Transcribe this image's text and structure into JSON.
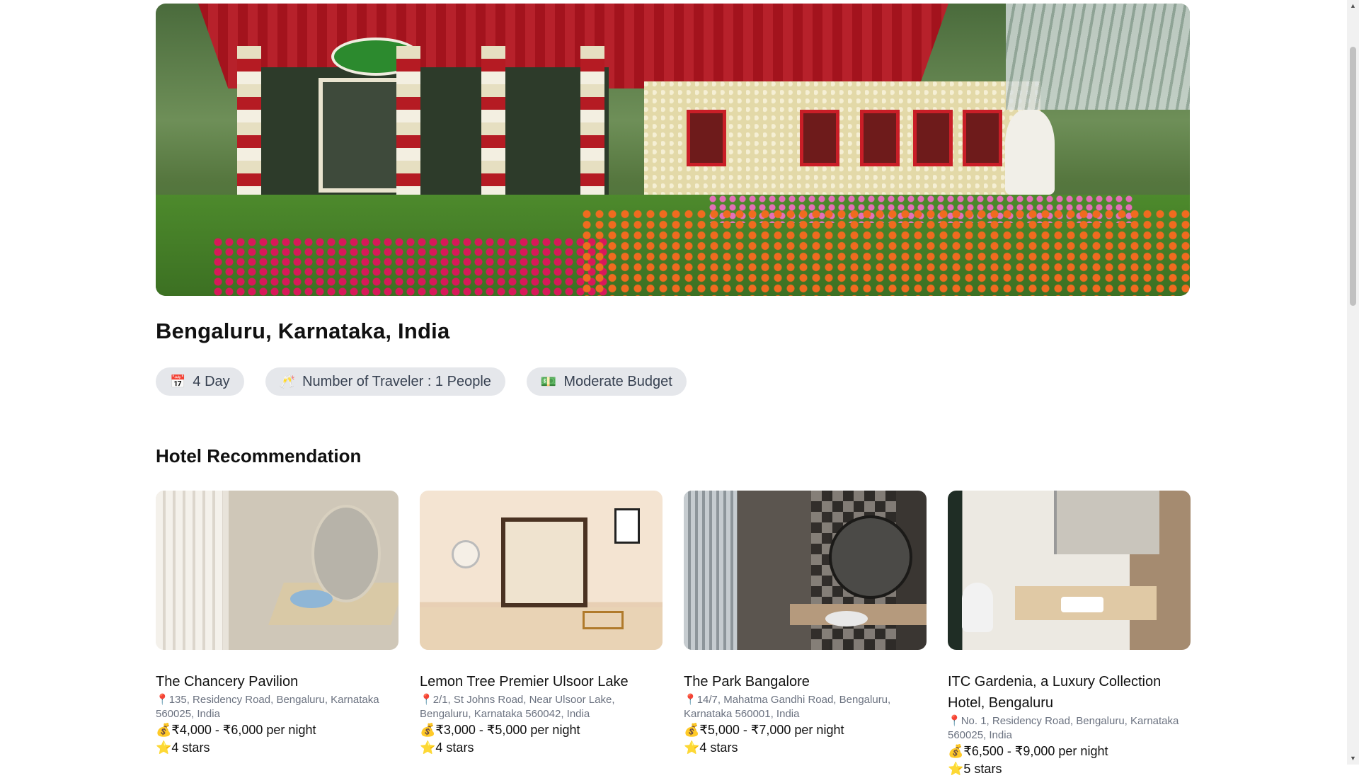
{
  "trip": {
    "location": "Bengaluru, Karnataka, India",
    "chips": [
      {
        "icon": "calendar-icon",
        "emoji": "📅",
        "label": "4 Day"
      },
      {
        "icon": "traveler-icon",
        "emoji": "🥂",
        "label": "Number of Traveler : 1 People"
      },
      {
        "icon": "money-icon",
        "emoji": "💵",
        "label": "Moderate Budget"
      }
    ]
  },
  "hotels_section": {
    "title": "Hotel Recommendation",
    "items": [
      {
        "name": "The Chancery Pavilion",
        "address": "135, Residency Road, Bengaluru, Karnataka 560025, India",
        "price": "₹4,000 - ₹6,000 per night",
        "rating": "4 stars"
      },
      {
        "name": "Lemon Tree Premier Ulsoor Lake",
        "address": "2/1, St Johns Road, Near Ulsoor Lake, Bengaluru, Karnataka 560042, India",
        "price": "₹3,000 - ₹5,000 per night",
        "rating": "4 stars"
      },
      {
        "name": "The Park Bangalore",
        "address": "14/7, Mahatma Gandhi Road, Bengaluru, Karnataka 560001, India",
        "price": "₹5,000 - ₹7,000 per night",
        "rating": "4 stars"
      },
      {
        "name": "ITC Gardenia, a Luxury Collection Hotel, Bengaluru",
        "address": "No. 1, Residency Road, Bengaluru, Karnataka 560025, India",
        "price": "₹6,500 - ₹9,000 per night",
        "rating": "5 stars"
      }
    ]
  },
  "icons": {
    "pin": "📍",
    "money_bag": "💰",
    "star": "⭐"
  },
  "colors": {
    "chip_bg": "#e5e7eb",
    "address_text": "#6b7280"
  }
}
